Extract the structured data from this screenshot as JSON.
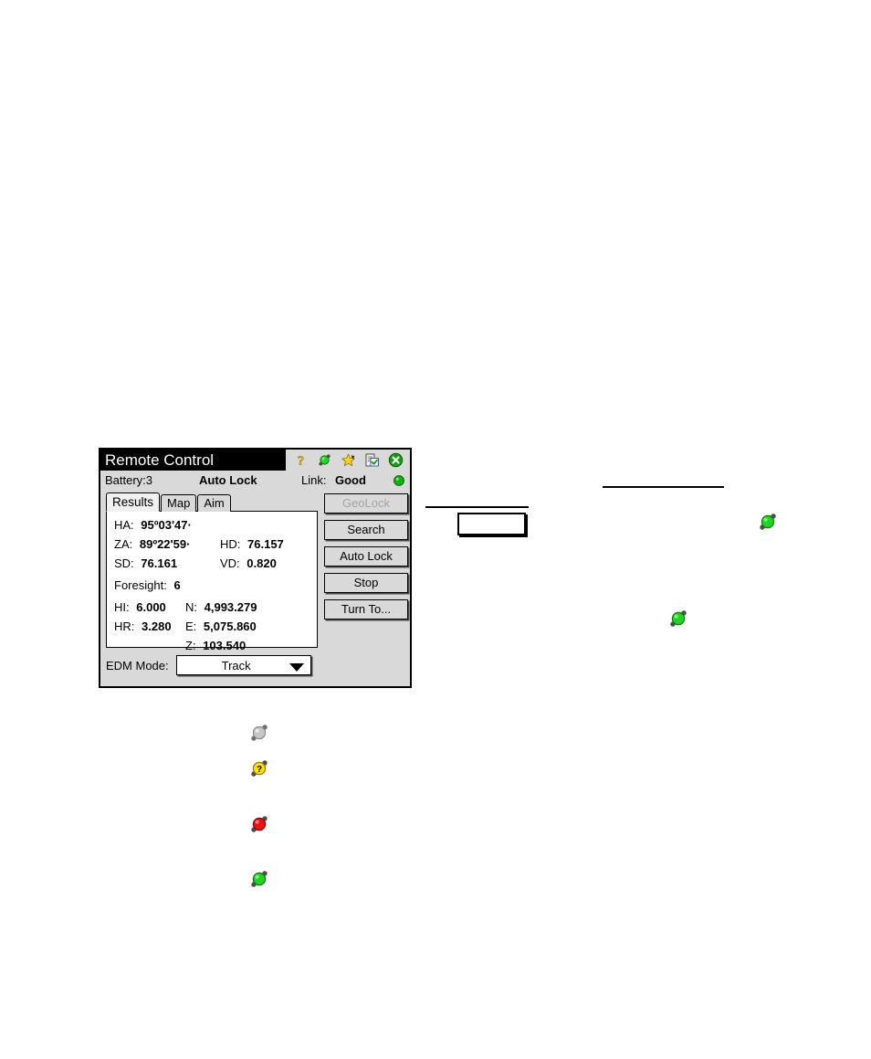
{
  "window": {
    "title": "Remote Control",
    "title_icons": [
      {
        "name": "help-icon",
        "glyph": "?"
      },
      {
        "name": "prism-lock-icon",
        "glyph": "prism"
      },
      {
        "name": "favorites-star-icon",
        "glyph": "star"
      },
      {
        "name": "notes-checklist-icon",
        "glyph": "clipboard"
      },
      {
        "name": "close-icon",
        "glyph": "x"
      }
    ],
    "status": {
      "battery_label": "Battery:3",
      "mode_label": "Auto Lock",
      "link_label": "Link:",
      "link_value": "Good",
      "link_indicator_color": "#00b400"
    },
    "tabs": [
      {
        "label": "Results",
        "active": true
      },
      {
        "label": "Map",
        "active": false
      },
      {
        "label": "Aim",
        "active": false
      }
    ],
    "results": {
      "ha_label": "HA:",
      "ha_value": "95º03'47·",
      "za_label": "ZA:",
      "za_value": "89º22'59·",
      "hd_label": "HD:",
      "hd_value": "76.157",
      "sd_label": "SD:",
      "sd_value": "76.161",
      "vd_label": "VD:",
      "vd_value": "0.820",
      "foresight_label": "Foresight:",
      "foresight_value": "6",
      "hi_label": "HI:",
      "hi_value": "6.000",
      "hr_label": "HR:",
      "hr_value": "3.280",
      "n_label": "N:",
      "n_value": "4,993.279",
      "e_label": "E:",
      "e_value": "5,075.860",
      "z_label": "Z:",
      "z_value": "103.540"
    },
    "buttons": [
      {
        "label": "GeoLock",
        "disabled": true
      },
      {
        "label": "Search",
        "disabled": false
      },
      {
        "label": "Auto Lock",
        "disabled": false
      },
      {
        "label": "Stop",
        "disabled": false
      },
      {
        "label": "Turn To...",
        "disabled": false
      }
    ],
    "edm": {
      "label": "EDM Mode:",
      "value": "Track",
      "options": [
        "Track"
      ]
    }
  },
  "annotations": {
    "callout_box_text": "",
    "loose_icons": [
      {
        "name": "prism-status-green-icon",
        "state": "locked",
        "color": "#22d422"
      },
      {
        "name": "prism-status-green-icon",
        "state": "locked",
        "color": "#22d422"
      },
      {
        "name": "prism-status-gray-icon",
        "state": "no-target",
        "color": "#c6c6c6"
      },
      {
        "name": "prism-status-search-icon",
        "state": "searching",
        "color": "#ffe000"
      },
      {
        "name": "prism-status-red-icon",
        "state": "lost",
        "color": "#f01010"
      },
      {
        "name": "prism-status-green-icon",
        "state": "locked",
        "color": "#22d422"
      }
    ]
  }
}
